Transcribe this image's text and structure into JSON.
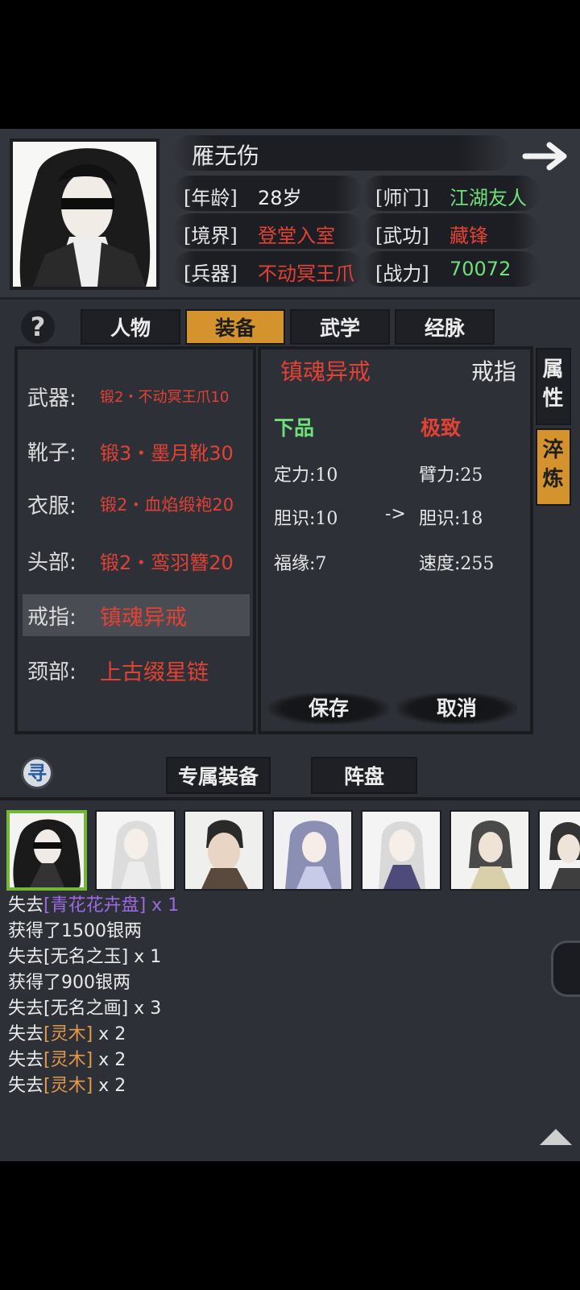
{
  "header": {
    "name": "雁无伤",
    "rows": [
      {
        "label": "[年龄]",
        "value": "28岁",
        "color": "white"
      },
      {
        "label": "[师门]",
        "value": "江湖友人",
        "color": "green"
      },
      {
        "label": "[境界]",
        "value": "登堂入室",
        "color": "red"
      },
      {
        "label": "[武功]",
        "value": "藏锋",
        "color": "red"
      },
      {
        "label": "[兵器]",
        "value": "不动冥王爪",
        "color": "red"
      },
      {
        "label": "[战力]",
        "value": "70072",
        "color": "green"
      }
    ],
    "next_icon": "arrow-right-icon"
  },
  "tabs": [
    "人物",
    "装备",
    "武学",
    "经脉"
  ],
  "active_tab": "装备",
  "help_label": "?",
  "equipment": [
    {
      "slot": "武器:",
      "item": "锻2・不动冥王爪10"
    },
    {
      "slot": "靴子:",
      "item": "锻3・墨月靴30"
    },
    {
      "slot": "衣服:",
      "item": "锻2・血焰缎袍20"
    },
    {
      "slot": "头部:",
      "item": "锻2・鸾羽簪20"
    },
    {
      "slot": "戒指:",
      "item": "镇魂异戒"
    },
    {
      "slot": "颈部:",
      "item": "上古缀星链"
    }
  ],
  "selected_slot": "戒指:",
  "detail": {
    "item_name": "镇魂异戒",
    "slot_type": "戒指",
    "current_grade": "下品",
    "target_grade": "极致",
    "current_stats": [
      "定力:10",
      "胆识:10",
      "福缘:7"
    ],
    "arrow": "->",
    "target_stats": [
      "臂力:25",
      "胆识:18",
      "速度:255"
    ],
    "save_label": "保存",
    "cancel_label": "取消"
  },
  "side_tabs": [
    "属性",
    "淬炼"
  ],
  "active_side_tab": "淬炼",
  "lower_buttons": {
    "search_label": "寻",
    "exclusive_label": "专属装备",
    "formation_label": "阵盘"
  },
  "log": [
    {
      "prefix": "失去",
      "item": "[青花花卉盘]",
      "suffix": " x 1",
      "color": "purple"
    },
    {
      "prefix": "获得了1500银两",
      "item": "",
      "suffix": "",
      "color": "white"
    },
    {
      "prefix": "失去",
      "item": "[无名之玉]",
      "suffix": " x 1",
      "color": "white"
    },
    {
      "prefix": "获得了900银两",
      "item": "",
      "suffix": "",
      "color": "white"
    },
    {
      "prefix": "失去",
      "item": "[无名之画]",
      "suffix": " x 3",
      "color": "white"
    },
    {
      "prefix": "失去",
      "item": "[灵木]",
      "suffix": " x 2",
      "color": "orange"
    },
    {
      "prefix": "失去",
      "item": "[灵木]",
      "suffix": " x 2",
      "color": "orange"
    },
    {
      "prefix": "失去",
      "item": "[灵木]",
      "suffix": " x 2",
      "color": "orange"
    }
  ],
  "colors": {
    "accent": "#d4932d",
    "red": "#e24234",
    "green": "#6fe07a",
    "purple": "#9b69e0",
    "orange": "#e39a4a"
  }
}
